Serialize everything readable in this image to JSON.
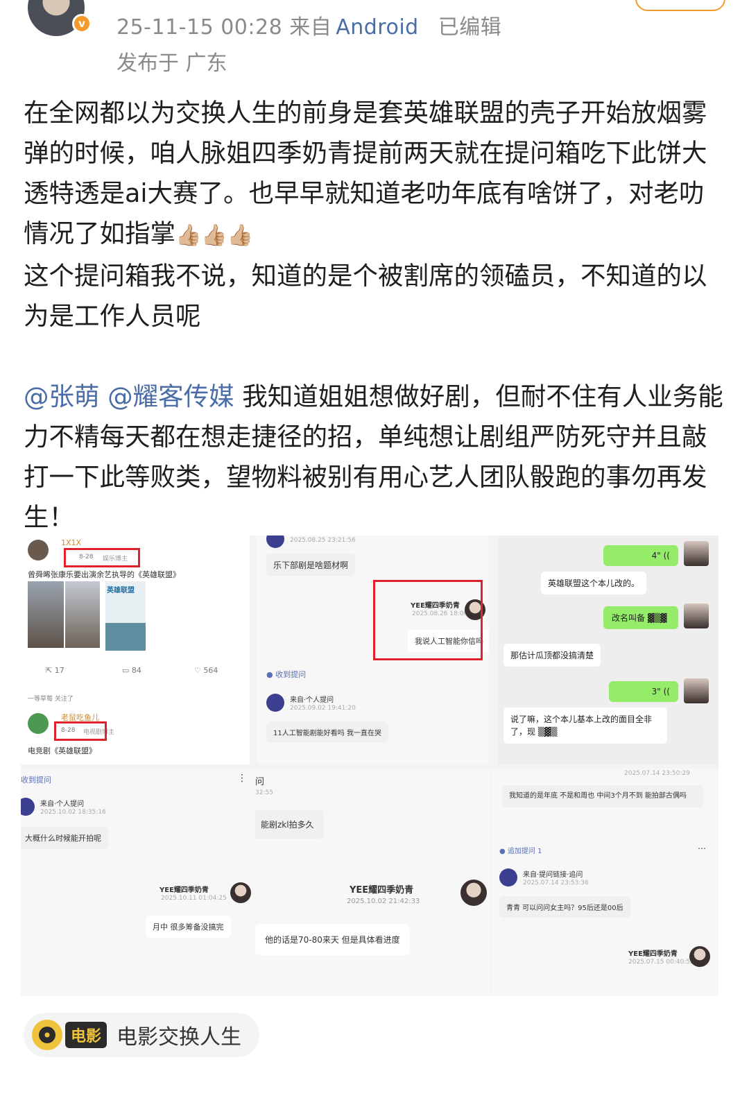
{
  "header": {
    "avatar_badge": "v",
    "time": "25-11-15 00:28",
    "source_prefix": "来自",
    "source": "Android",
    "edited": "已编辑",
    "location": "发布于 广东"
  },
  "post": {
    "paragraph1": "在全网都以为交换人生的前身是套英雄联盟的壳子开始放烟雾弹的时候，咱人脉姐四季奶青提前两天就在提问箱吃下此饼大透特透是ai大赛了。也早早就知道老叻年底有啥饼了，对老叻情况了如指掌",
    "emoji": "👍🏼👍🏼👍🏼",
    "paragraph2": "这个提问箱我不说，知道的是个被割席的领磕员，不知道的以为是工作人员呢",
    "mention1": "@张萌",
    "mention2": "@耀客传媒",
    "paragraph3": "我知道姐姐想做好剧，但耐不住有人业务能力不精每天都在想走捷径的招，单纯想让剧组严防死守并且敲打一下此等败类，望物料被别有用心艺人团队骰跑的事勿再发生！"
  },
  "collage": {
    "t1": {
      "user": "1X1X",
      "date": "8-28",
      "role": "娱乐博主",
      "text": "曾舜晞张康乐要出演余艺执导的《英雄联盟》",
      "poster": "英雄联盟",
      "share": "17",
      "comments": "84",
      "likes": "564"
    },
    "t2": {
      "follow_note": "一等草莓 关注了",
      "user": "老鼠吃鱼儿",
      "date": "8-28",
      "role": "电视剧博主",
      "text": "电竞剧《英雄联盟》"
    },
    "t3": {
      "ts1": "2025.08.25 23:21:56",
      "q1": "乐下部剧是啥题材啊",
      "name": "YEE耀四季奶青",
      "ts2": "2025.08.26 18:06:43",
      "a1": "我说人工智能你信吗",
      "received": "收到提问",
      "from": "来自·个人提问",
      "ts3": "2025.09.02 19:41:20",
      "q2": "11人工智能剧能好看吗 我一直在哭"
    },
    "t4": {
      "v1": "4\"",
      "m1": "英雄联盟这个本儿改的。",
      "m2": "改名叫备",
      "m3": "那估计瓜顶都没搞清楚",
      "v2": "3\"",
      "m4": "说了嘛，这个本儿基本上改的面目全非了，现"
    },
    "t5": {
      "received": "收到提问",
      "from": "来自·个人提问",
      "ts1": "2025.10.02 18:35:16",
      "q": "大概什么时候能开拍呢",
      "name": "YEE耀四季奶青",
      "ts2": "2025.10.11 01:04:25",
      "a": "月中 很多筹备没搞完"
    },
    "t6": {
      "header": "问",
      "ts1": "32:55",
      "q": "能剧zkl拍多久",
      "name": "YEE耀四季奶青",
      "ts2": "2025.10.02 21:42:33",
      "a": "他的话是70-80来天 但是具体看进度"
    },
    "t7": {
      "ts1": "2025.07.14 23:50:29",
      "q1": "我知道的是年底 不是和周也 中间3个月不到 能拍部古偶吗",
      "followup": "追加提问 1",
      "from": "来自·提问链接·追问",
      "ts2": "2025.07.14 23:53:36",
      "q2": "青青 可以问问女主吗？95后还是00后",
      "name": "YEE耀四季奶青",
      "ts3": "2025.07.15 00:40:52"
    }
  },
  "movie_tag": {
    "chip": "电影",
    "name": "电影交换人生"
  },
  "colors": {
    "mention": "#4a6da7",
    "meta": "#8a8a8a",
    "accent": "#f39a2b",
    "highlight_box": "#e0202a"
  }
}
